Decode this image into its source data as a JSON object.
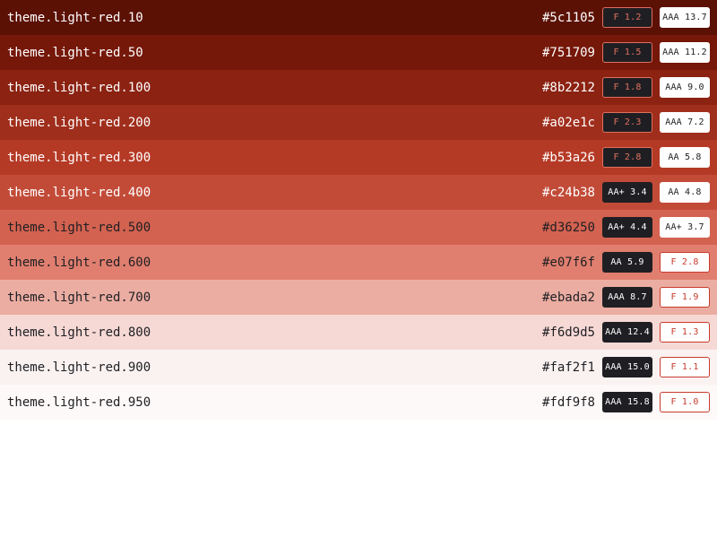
{
  "colors": {
    "dark_badge_bg": "#1f1f23",
    "light_badge_bg": "#ffffff",
    "fail_text": "#e0705f",
    "fail_light_text": "#c83a2c",
    "pass_dark_text": "#ffffff",
    "pass_light_text": "#1f1f23"
  },
  "rows": [
    {
      "name": "theme.light-red.10",
      "hex": "#5c1105",
      "text_color": "#ffffff",
      "on_dark": "F 1.2",
      "on_dark_pass": false,
      "on_light": "AAA 13.7",
      "on_light_pass": true
    },
    {
      "name": "theme.light-red.50",
      "hex": "#751709",
      "text_color": "#ffffff",
      "on_dark": "F 1.5",
      "on_dark_pass": false,
      "on_light": "AAA 11.2",
      "on_light_pass": true
    },
    {
      "name": "theme.light-red.100",
      "hex": "#8b2212",
      "text_color": "#ffffff",
      "on_dark": "F 1.8",
      "on_dark_pass": false,
      "on_light": "AAA 9.0",
      "on_light_pass": true
    },
    {
      "name": "theme.light-red.200",
      "hex": "#a02e1c",
      "text_color": "#ffffff",
      "on_dark": "F 2.3",
      "on_dark_pass": false,
      "on_light": "AAA 7.2",
      "on_light_pass": true
    },
    {
      "name": "theme.light-red.300",
      "hex": "#b53a26",
      "text_color": "#ffffff",
      "on_dark": "F 2.8",
      "on_dark_pass": false,
      "on_light": "AA 5.8",
      "on_light_pass": true
    },
    {
      "name": "theme.light-red.400",
      "hex": "#c24b38",
      "text_color": "#ffffff",
      "on_dark": "AA+ 3.4",
      "on_dark_pass": true,
      "on_light": "AA 4.8",
      "on_light_pass": true
    },
    {
      "name": "theme.light-red.500",
      "hex": "#d36250",
      "text_color": "#1f1f23",
      "on_dark": "AA+ 4.4",
      "on_dark_pass": true,
      "on_light": "AA+ 3.7",
      "on_light_pass": true
    },
    {
      "name": "theme.light-red.600",
      "hex": "#e07f6f",
      "text_color": "#1f1f23",
      "on_dark": "AA 5.9",
      "on_dark_pass": true,
      "on_light": "F 2.8",
      "on_light_pass": false
    },
    {
      "name": "theme.light-red.700",
      "hex": "#ebada2",
      "text_color": "#1f1f23",
      "on_dark": "AAA 8.7",
      "on_dark_pass": true,
      "on_light": "F 1.9",
      "on_light_pass": false
    },
    {
      "name": "theme.light-red.800",
      "hex": "#f6d9d5",
      "text_color": "#1f1f23",
      "on_dark": "AAA 12.4",
      "on_dark_pass": true,
      "on_light": "F 1.3",
      "on_light_pass": false
    },
    {
      "name": "theme.light-red.900",
      "hex": "#faf2f1",
      "text_color": "#1f1f23",
      "on_dark": "AAA 15.0",
      "on_dark_pass": true,
      "on_light": "F 1.1",
      "on_light_pass": false
    },
    {
      "name": "theme.light-red.950",
      "hex": "#fdf9f8",
      "text_color": "#1f1f23",
      "on_dark": "AAA 15.8",
      "on_dark_pass": true,
      "on_light": "F 1.0",
      "on_light_pass": false
    }
  ]
}
